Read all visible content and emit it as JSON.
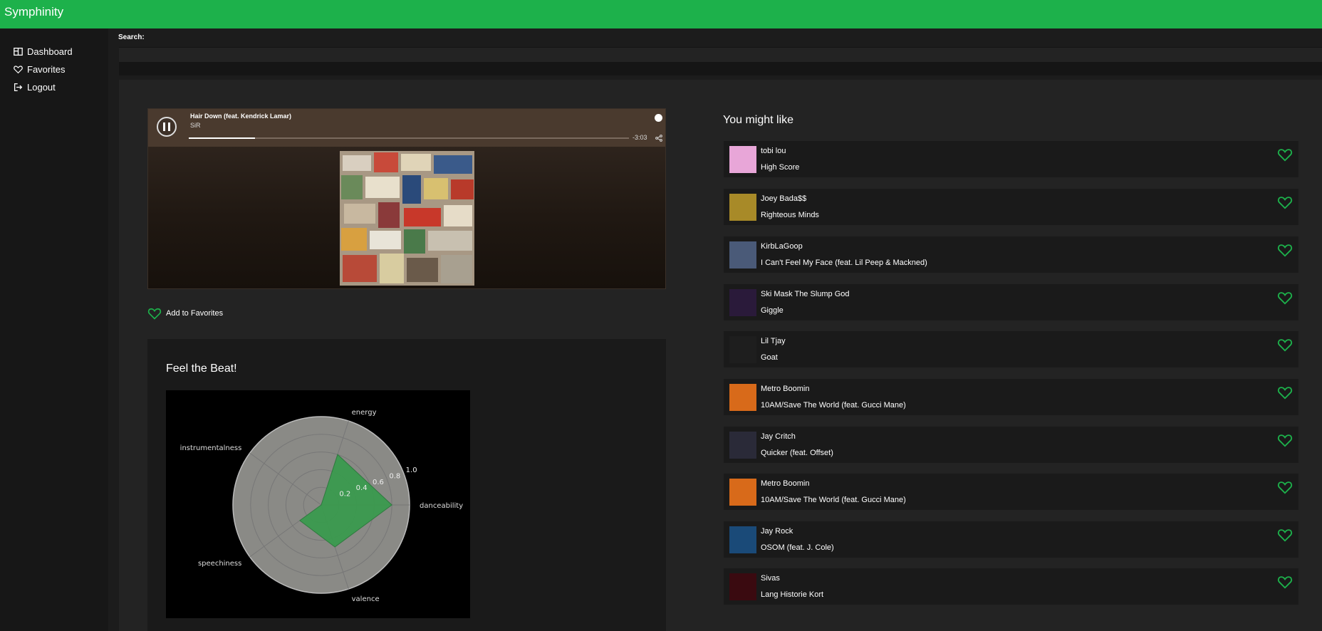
{
  "app": {
    "title": "Symphinity",
    "accent": "#1db14b"
  },
  "sidebar": {
    "items": [
      {
        "label": "Dashboard",
        "icon": "dashboard-icon"
      },
      {
        "label": "Favorites",
        "icon": "heart-icon"
      },
      {
        "label": "Logout",
        "icon": "logout-icon"
      }
    ]
  },
  "search": {
    "label": "Search:",
    "value": ""
  },
  "player": {
    "title": "Hair Down (feat. Kendrick Lamar)",
    "artist": "SiR",
    "time_remaining": "-3:03",
    "progress": 0.15
  },
  "favorites_button": {
    "label": "Add to Favorites"
  },
  "beat": {
    "title": "Feel the Beat!",
    "chart_data": {
      "type": "radar",
      "axes": [
        "danceability",
        "energy",
        "instrumentalness",
        "speechiness",
        "valence"
      ],
      "values": [
        0.8,
        0.6,
        0.0,
        0.3,
        0.5
      ],
      "rlim": [
        0,
        1.0
      ],
      "ticks": [
        "0.2",
        "0.4",
        "0.6",
        "0.8",
        "1.0"
      ],
      "fill_color": "#3a9a4e"
    }
  },
  "recommendations": {
    "title": "You might like",
    "items": [
      {
        "artist": "tobi lou",
        "track": "High Score",
        "color": "#e8a6d8"
      },
      {
        "artist": "Joey Bada$$",
        "track": "Righteous Minds",
        "color": "#a88a28"
      },
      {
        "artist": "KirbLaGoop",
        "track": "I Can't Feel My Face (feat. Lil Peep & Mackned)",
        "color": "#4a5a78"
      },
      {
        "artist": "Ski Mask The Slump God",
        "track": "Giggle",
        "color": "#2a1a3a"
      },
      {
        "artist": "Lil Tjay",
        "track": "Goat",
        "color": "#1e1e1e"
      },
      {
        "artist": "Metro Boomin",
        "track": "10AM/Save The World (feat. Gucci Mane)",
        "color": "#d86a1a"
      },
      {
        "artist": "Jay Critch",
        "track": "Quicker (feat. Offset)",
        "color": "#2a2a38"
      },
      {
        "artist": "Metro Boomin",
        "track": "10AM/Save The World (feat. Gucci Mane)",
        "color": "#d86a1a"
      },
      {
        "artist": "Jay Rock",
        "track": "OSOM (feat. J. Cole)",
        "color": "#1a4a78"
      },
      {
        "artist": "Sivas",
        "track": "Lang Historie Kort",
        "color": "#3a0a10"
      }
    ]
  }
}
